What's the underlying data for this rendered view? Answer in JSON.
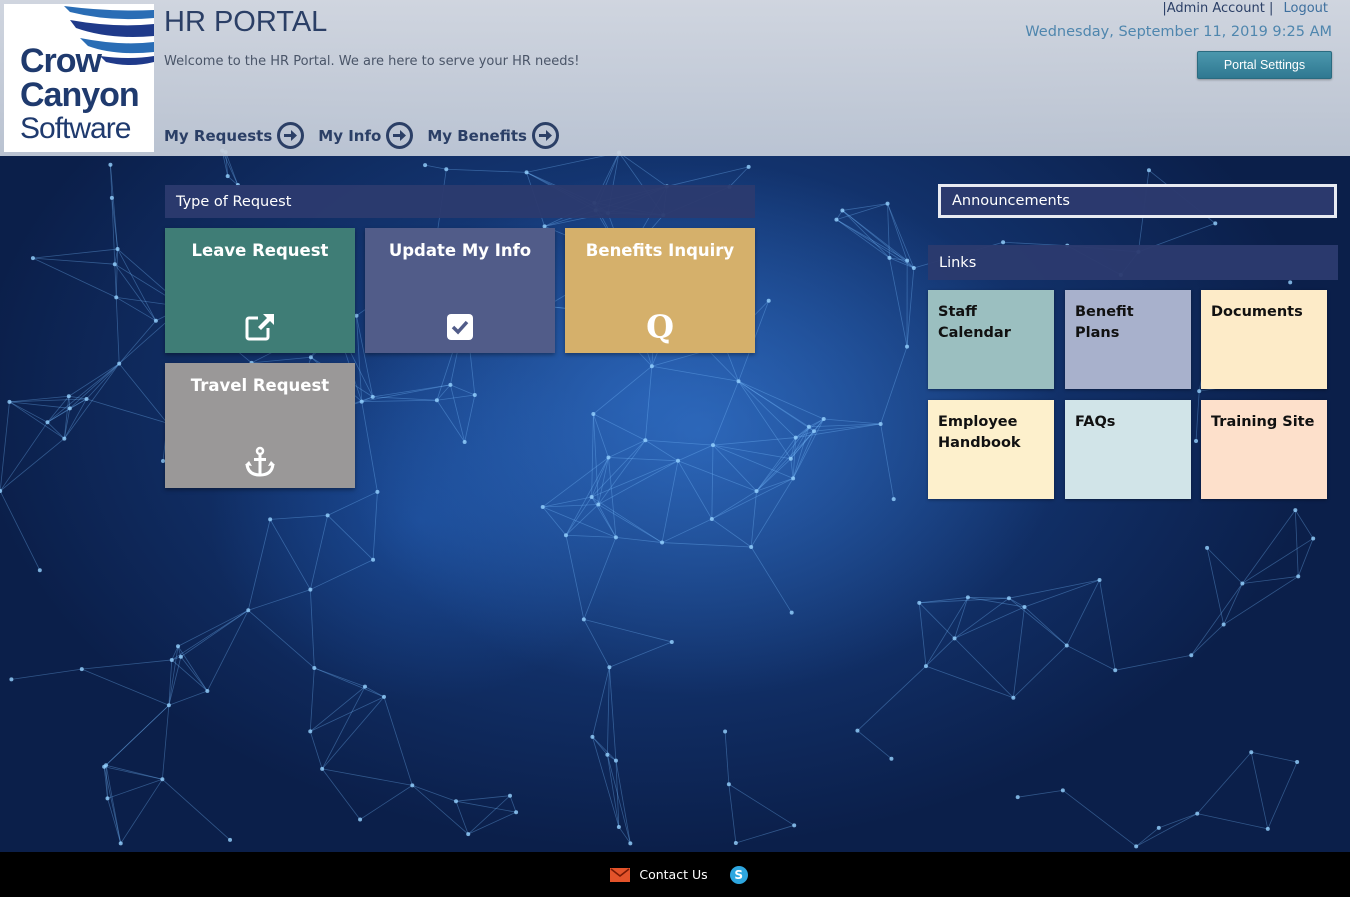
{
  "header": {
    "logo": {
      "line1": "Crow",
      "line2": "Canyon",
      "line3": "Software"
    },
    "title": "HR PORTAL",
    "welcome": "Welcome to the HR Portal. We are here to serve your HR needs!",
    "nav": [
      {
        "label": "My Requests",
        "icon": "arrow-right-circle-icon"
      },
      {
        "label": "My Info",
        "icon": "arrow-right-circle-icon"
      },
      {
        "label": "My Benefits",
        "icon": "arrow-right-circle-icon"
      }
    ],
    "user": {
      "sep": "|",
      "account": "Admin Account",
      "logout": "Logout"
    },
    "datetime": "Wednesday, September 11, 2019 9:25 AM",
    "portal_settings": "Portal Settings"
  },
  "requests": {
    "heading": "Type of Request",
    "tiles": [
      {
        "label": "Leave Request",
        "icon": "external-link-icon",
        "color": "#3f7d76"
      },
      {
        "label": "Update My Info",
        "icon": "checkbox-icon",
        "color": "#515c89"
      },
      {
        "label": "Benefits Inquiry",
        "icon": "q-icon",
        "color": "#d5b06b"
      },
      {
        "label": "Travel Request",
        "icon": "anchor-icon",
        "color": "#9a9898"
      }
    ]
  },
  "announcements": {
    "heading": "Announcements"
  },
  "links": {
    "heading": "Links",
    "tiles": [
      {
        "label": "Staff Calendar",
        "color": "#9bbfc0"
      },
      {
        "label": "Benefit Plans",
        "color": "#a8b1cc"
      },
      {
        "label": "Documents",
        "color": "#fdebc8"
      },
      {
        "label": "Employee Handbook",
        "color": "#fdf0cc"
      },
      {
        "label": "FAQs",
        "color": "#d1e4e8"
      },
      {
        "label": "Training Site",
        "color": "#fde0cb"
      }
    ]
  },
  "footer": {
    "contact": "Contact Us",
    "mail_icon": "mail-icon",
    "skype_icon": "skype-icon",
    "skype_glyph": "S"
  }
}
